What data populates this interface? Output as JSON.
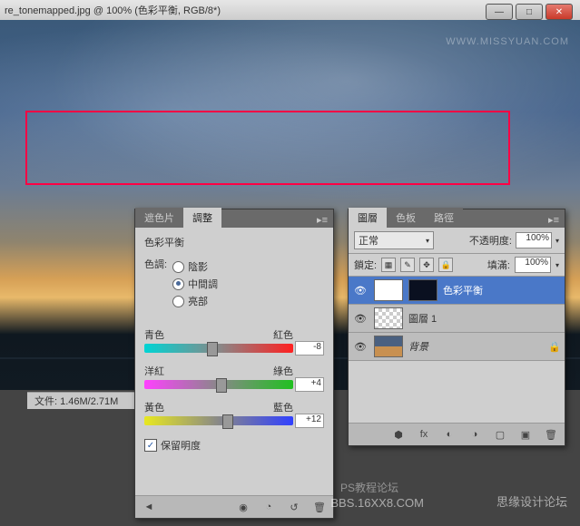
{
  "titlebar": {
    "filename": "re_tonemapped.jpg @ 100% (色彩平衡, RGB/8*)"
  },
  "win": {
    "min": "—",
    "max": "□",
    "close": "✕"
  },
  "status": {
    "file": "文件: 1.46M/2.71M"
  },
  "adjust": {
    "tabs": {
      "masks": "遮色片",
      "adjustments": "調整"
    },
    "title": "色彩平衡",
    "tone_label": "色調:",
    "tones": {
      "shadows": "陰影",
      "midtones": "中間調",
      "highlights": "亮部"
    },
    "sliders": {
      "cyan": "青色",
      "red": "紅色",
      "cyan_val": "-8",
      "magenta": "洋紅",
      "green": "綠色",
      "magenta_val": "+4",
      "yellow": "黃色",
      "blue": "藍色",
      "yellow_val": "+12"
    },
    "preserve": "保留明度",
    "check": "✓"
  },
  "layers": {
    "tabs": {
      "layers": "圖層",
      "channels": "色板",
      "paths": "路徑"
    },
    "blend": "正常",
    "opacity_label": "不透明度:",
    "opacity": "100%",
    "lock_label": "鎖定:",
    "fill_label": "填滿:",
    "fill": "100%",
    "items": {
      "cb": "色彩平衡",
      "l1": "圖層 1",
      "bg": "背景"
    },
    "eye": "👁"
  },
  "icons": {
    "arrow": "◄",
    "eye": "◉",
    "reset": "↺",
    "trash": "🗑",
    "menu": "▸≡",
    "tri": "▾",
    "link": "⬢",
    "fx": "fx",
    "mask": "◐",
    "adj": "◑",
    "folder": "▢",
    "new": "▣",
    "lock": "🔒"
  },
  "watermarks": {
    "w1": "WWW.MISSYUAN.COM",
    "w2": "BBS.16XX8.COM",
    "w3": "思缘设计论坛",
    "w4": "PS教程论坛"
  },
  "chart_data": {
    "type": "table",
    "title": "Color Balance Adjustment",
    "tone": "midtones",
    "values": {
      "cyan_red": -8,
      "magenta_green": 4,
      "yellow_blue": 12
    },
    "preserve_luminosity": true
  }
}
